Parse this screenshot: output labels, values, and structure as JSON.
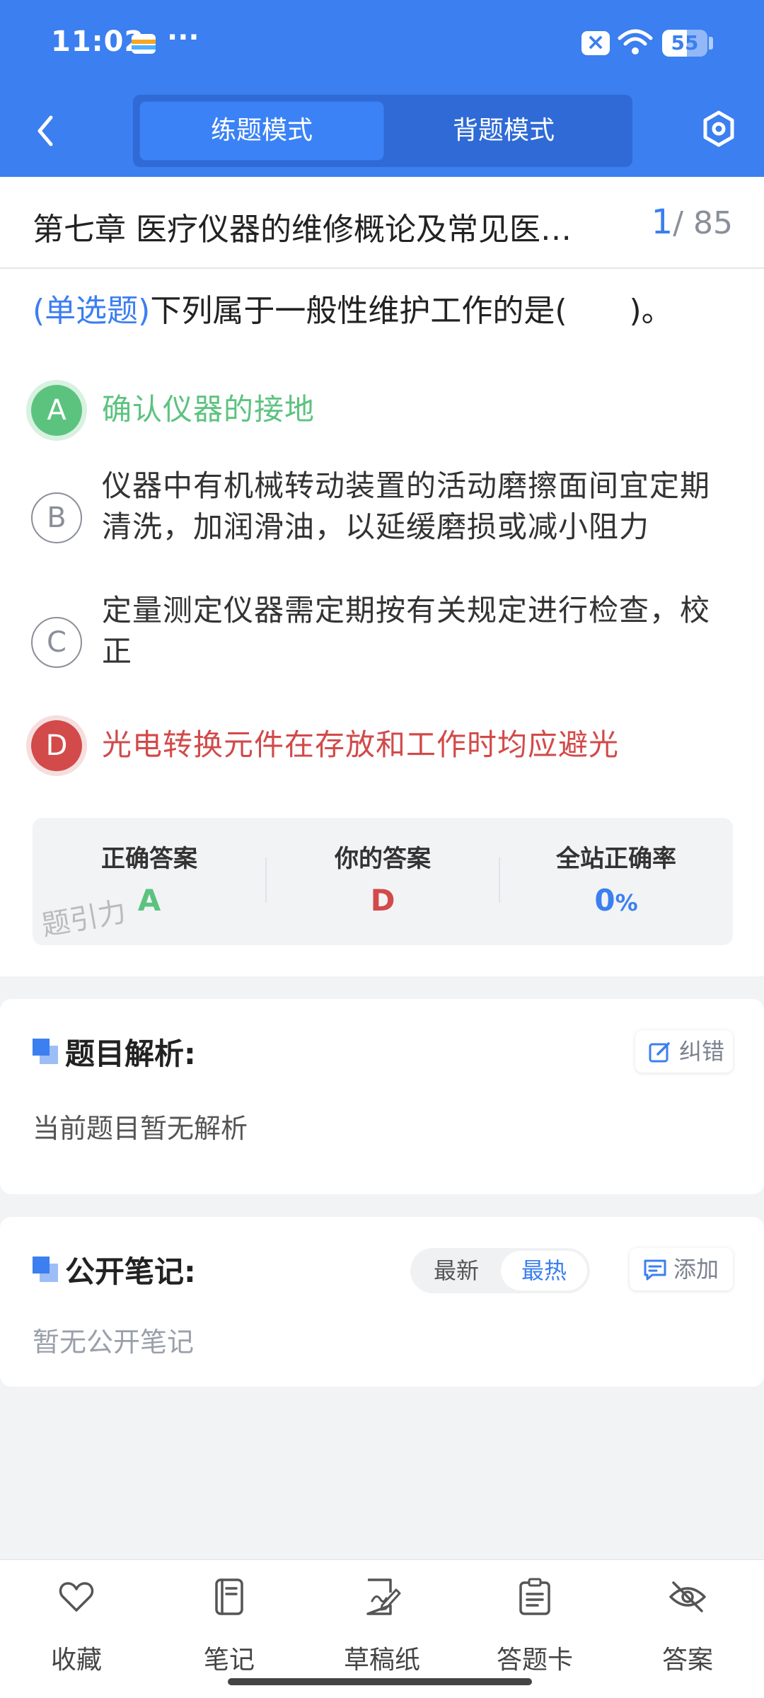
{
  "status_bar": {
    "time": "11:02",
    "battery": "55",
    "battery_level": 0.55
  },
  "header": {
    "modes": [
      {
        "label": "练题模式",
        "active": true
      },
      {
        "label": "背题模式",
        "active": false
      }
    ]
  },
  "chapter": {
    "title": "第七章 医疗仪器的维修概论及常见医…",
    "current": "1",
    "total": "/ 85"
  },
  "question": {
    "type": "(单选题)",
    "text": "下列属于一般性维护工作的是(　　)。",
    "options": [
      {
        "letter": "A",
        "text": "确认仪器的接地",
        "state": "correct"
      },
      {
        "letter": "B",
        "text": "仪器中有机械转动装置的活动磨擦面间宜定期清洗，加润滑油，以延缓磨损或减小阻力",
        "state": "plain"
      },
      {
        "letter": "C",
        "text": "定量测定仪器需定期按有关规定进行检查，校正",
        "state": "plain"
      },
      {
        "letter": "D",
        "text": "光电转换元件在存放和工作时均应避光",
        "state": "wrong"
      }
    ]
  },
  "answer_summary": {
    "correct_label": "正确答案",
    "correct_value": "A",
    "yours_label": "你的答案",
    "yours_value": "D",
    "rate_label": "全站正确率",
    "rate_value": "0",
    "rate_unit": "%",
    "watermark": "题引力",
    "colors": {
      "correct": "#5cc37f",
      "wrong": "#d24a4a",
      "rate": "#3b7ff0"
    }
  },
  "analysis": {
    "title": "题目解析:",
    "body": "当前题目暂无解析",
    "report_button": "纠错"
  },
  "notes": {
    "title": "公开笔记:",
    "sort_latest": "最新",
    "sort_hot": "最热",
    "add_button": "添加",
    "body": "暂无公开笔记"
  },
  "bottom_nav": [
    {
      "label": "收藏",
      "icon": "heart-icon"
    },
    {
      "label": "笔记",
      "icon": "notebook-icon"
    },
    {
      "label": "草稿纸",
      "icon": "draft-icon"
    },
    {
      "label": "答题卡",
      "icon": "answer-sheet-icon"
    },
    {
      "label": "答案",
      "icon": "eye-off-icon"
    }
  ],
  "colors": {
    "primary": "#3b7ff0",
    "header_bg": "#3b7ff0"
  }
}
